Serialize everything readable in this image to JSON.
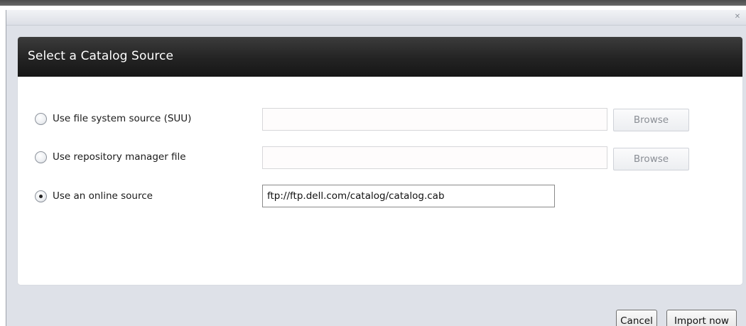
{
  "dialog": {
    "close_glyph": "✕",
    "header_title": "Select a Catalog Source"
  },
  "options": [
    {
      "label": "Use file system source (SUU)",
      "selected": false,
      "value": "",
      "browse_label": "Browse",
      "browse_enabled": false
    },
    {
      "label": "Use repository manager file",
      "selected": false,
      "value": "",
      "browse_label": "Browse",
      "browse_enabled": false
    },
    {
      "label": "Use an online source",
      "selected": true,
      "value": "ftp://ftp.dell.com/catalog/catalog.cab"
    }
  ],
  "footer": {
    "cancel_label": "Cancel",
    "import_label": "Import now"
  },
  "colors": {
    "header_bg": "#1e1e1e",
    "dialog_bg": "#dee1e8",
    "disabled_text": "#8a8e95"
  },
  "icons": {
    "close": "close-icon",
    "radio": "radio-button-icon"
  }
}
